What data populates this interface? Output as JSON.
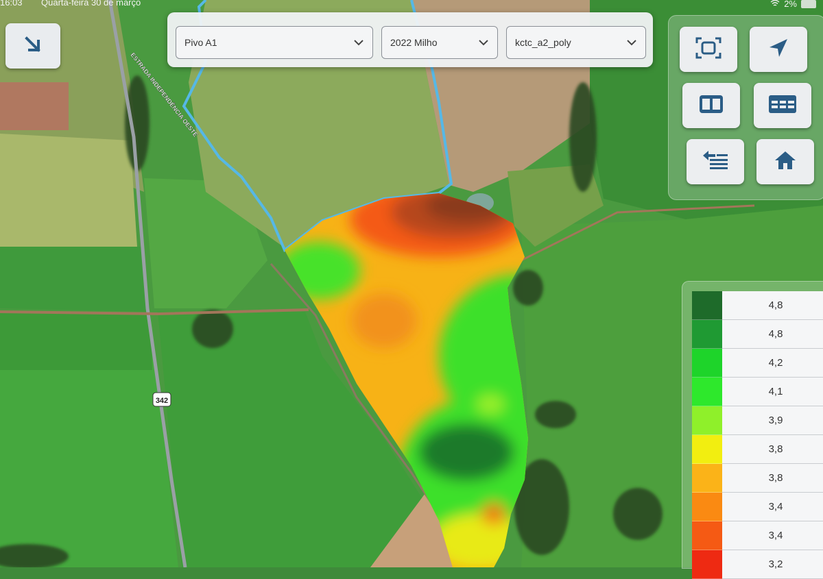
{
  "status_bar": {
    "time": "16:03",
    "date": "Quarta-feira 30 de março",
    "battery": "2%"
  },
  "toolbar": {
    "field": "Pivo A1",
    "season": "2022 Milho",
    "layer": "kctc_a2_poly"
  },
  "map": {
    "road_label": "ESTRADA INDEPENDÊNCIA OESTE",
    "road_shield": "342"
  },
  "tools": {
    "icons": [
      "fit-screen-icon",
      "navigation-arrow-icon",
      "split-view-icon",
      "table-icon",
      "layers-list-icon",
      "home-icon"
    ]
  },
  "legend": {
    "items": [
      {
        "color": "#1e6b2a",
        "value": "4,8"
      },
      {
        "color": "#1f9a33",
        "value": "4,8"
      },
      {
        "color": "#1ed42a",
        "value": "4,2"
      },
      {
        "color": "#2ee82c",
        "value": "4,1"
      },
      {
        "color": "#8ff02a",
        "value": "3,9"
      },
      {
        "color": "#f2ee10",
        "value": "3,8"
      },
      {
        "color": "#fbb318",
        "value": "3,8"
      },
      {
        "color": "#fa8a12",
        "value": "3,4"
      },
      {
        "color": "#f55a14",
        "value": "3,4"
      },
      {
        "color": "#ee2a12",
        "value": "3,2"
      }
    ]
  },
  "colors": {
    "boundary": "#56b8e6",
    "accent_icon": "#2b5d86"
  }
}
